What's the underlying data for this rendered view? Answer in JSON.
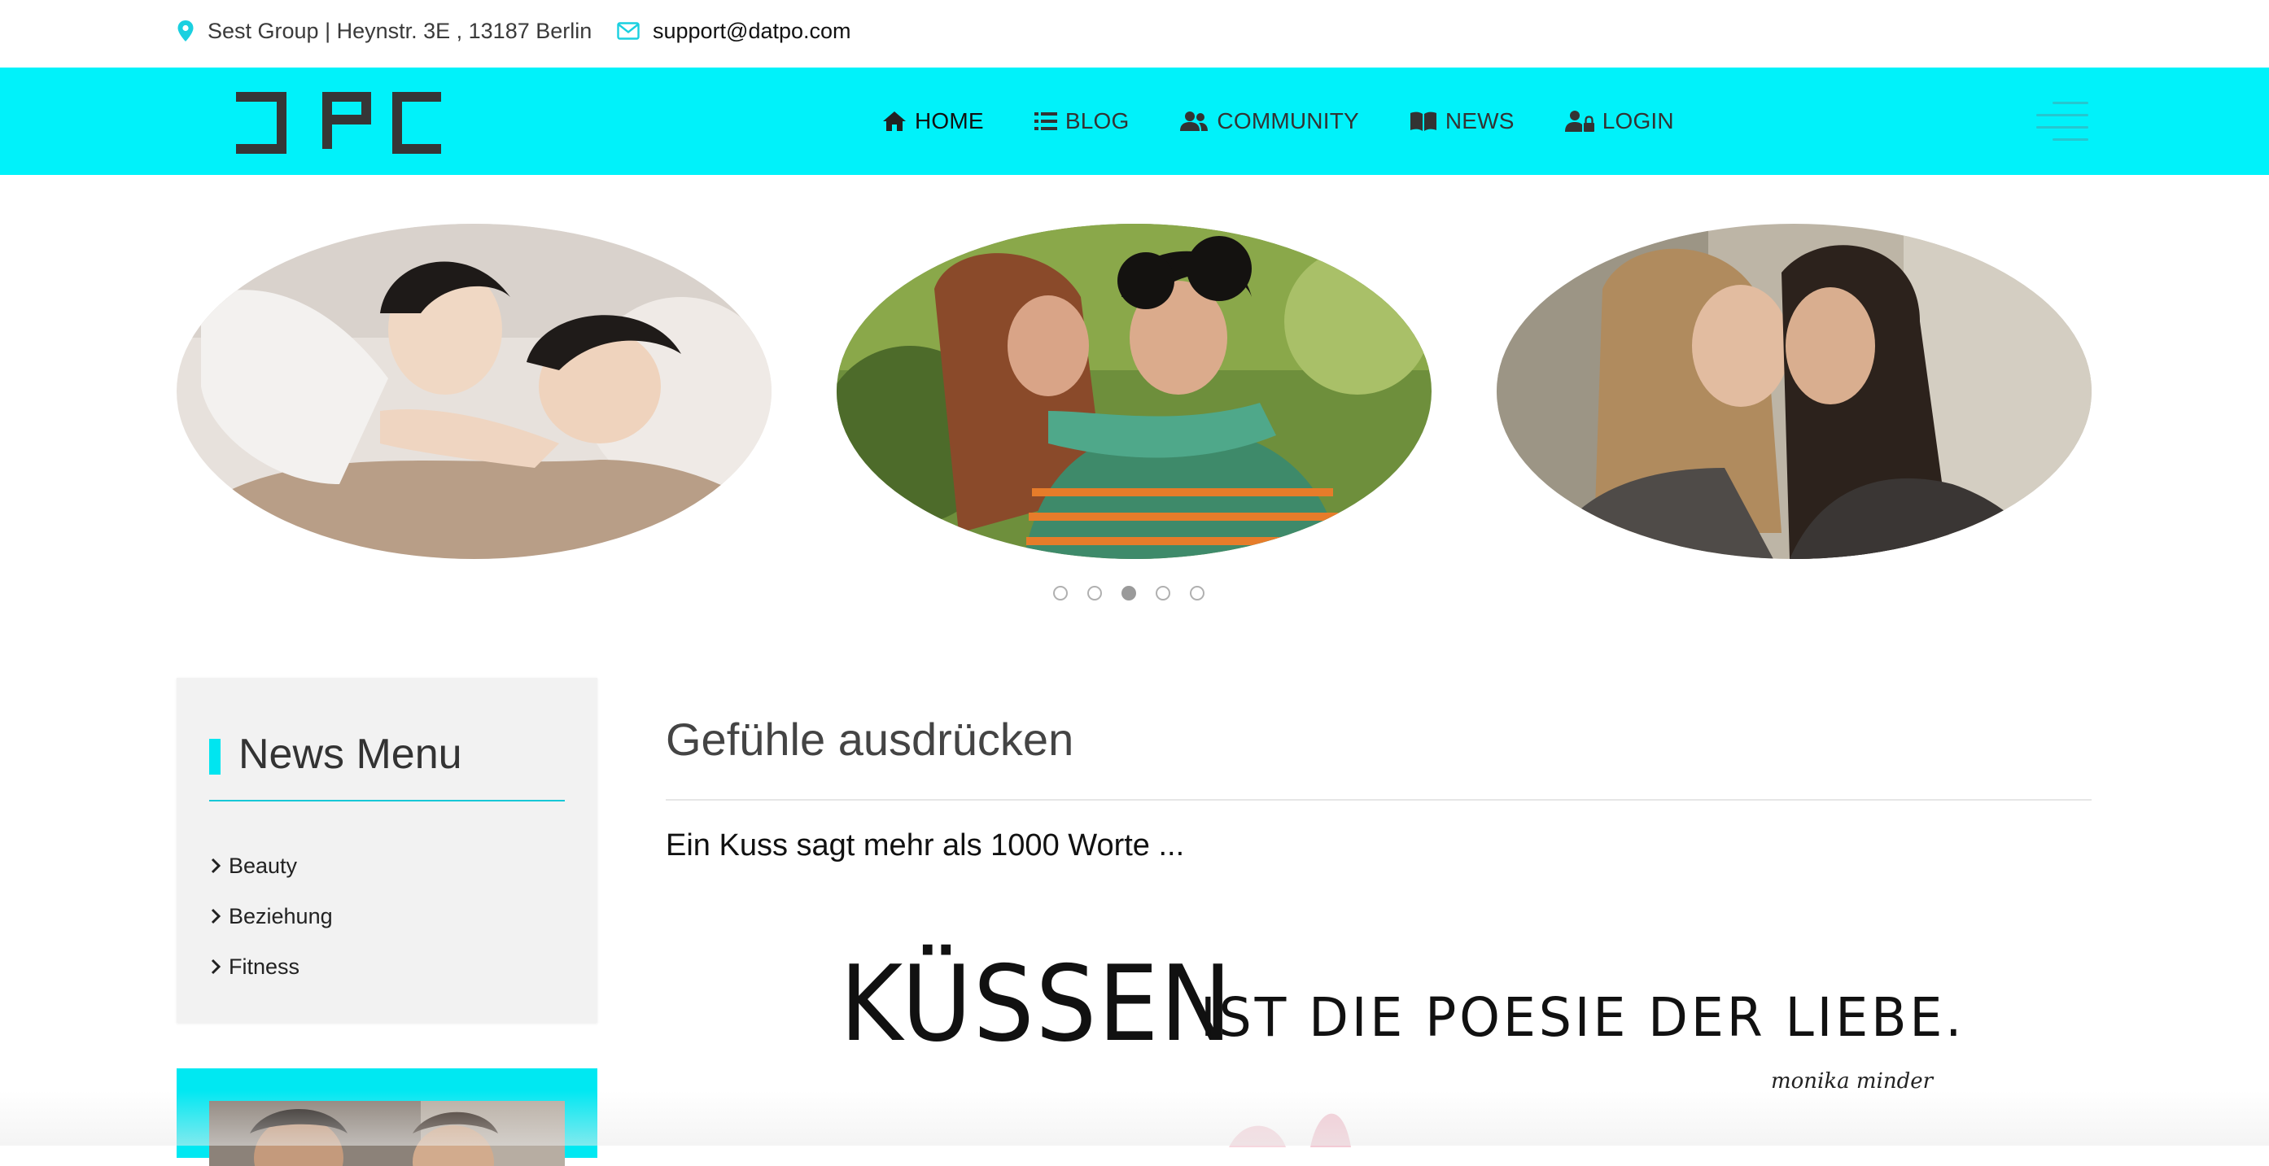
{
  "topbar": {
    "address": "Sest Group | Heynstr. 3E , 13187 Berlin",
    "email": "support@datpo.com"
  },
  "nav": {
    "logo_alt": "DPC",
    "items": [
      {
        "label": "HOME",
        "icon": "home-icon",
        "active": true
      },
      {
        "label": "BLOG",
        "icon": "list-icon",
        "active": false
      },
      {
        "label": "COMMUNITY",
        "icon": "users-icon",
        "active": false
      },
      {
        "label": "NEWS",
        "icon": "book-icon",
        "active": false
      },
      {
        "label": "LOGIN",
        "icon": "user-lock-icon",
        "active": false
      }
    ]
  },
  "carousel": {
    "dots": 5,
    "active_dot": 3
  },
  "sidebar": {
    "title": "News Menu",
    "items": [
      "Beauty",
      "Beziehung",
      "Fitness"
    ]
  },
  "article": {
    "title": "Gefühle ausdrücken",
    "subtitle": "Ein Kuss sagt mehr als 1000 Worte ...",
    "quote_main": "KÜSSEN",
    "quote_rest": "IST DIE POESIE DER LIEBE.",
    "quote_author": "monika minder"
  },
  "colors": {
    "accent": "#00f2fa",
    "accent_dark": "#17c8d6"
  }
}
